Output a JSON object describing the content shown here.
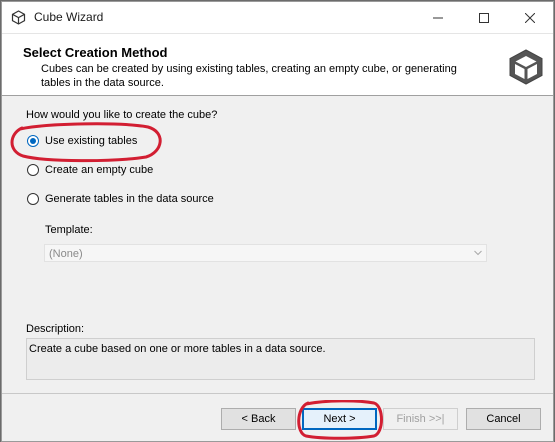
{
  "window": {
    "title": "Cube Wizard",
    "controls": {
      "minimize": "minimize-icon",
      "maximize": "maximize-icon",
      "close": "close-icon"
    }
  },
  "header": {
    "title": "Select Creation Method",
    "description": "Cubes can be created by using existing tables, creating an empty cube, or generating tables in the data source.",
    "icon": "cube-icon"
  },
  "main": {
    "question": "How would you like to create the cube?",
    "options": [
      {
        "label": "Use existing tables",
        "checked": true
      },
      {
        "label": "Create an empty cube",
        "checked": false
      },
      {
        "label": "Generate tables in the data source",
        "checked": false
      }
    ],
    "template": {
      "label": "Template:",
      "value": "(None)",
      "enabled": false
    },
    "description_label": "Description:",
    "description_text": "Create a cube based on one or more tables in a data source."
  },
  "buttons": {
    "back": "< Back",
    "next": "Next >",
    "finish": "Finish >>|",
    "cancel": "Cancel"
  },
  "colors": {
    "accent": "#0067c0",
    "annotation": "#d21e32"
  }
}
